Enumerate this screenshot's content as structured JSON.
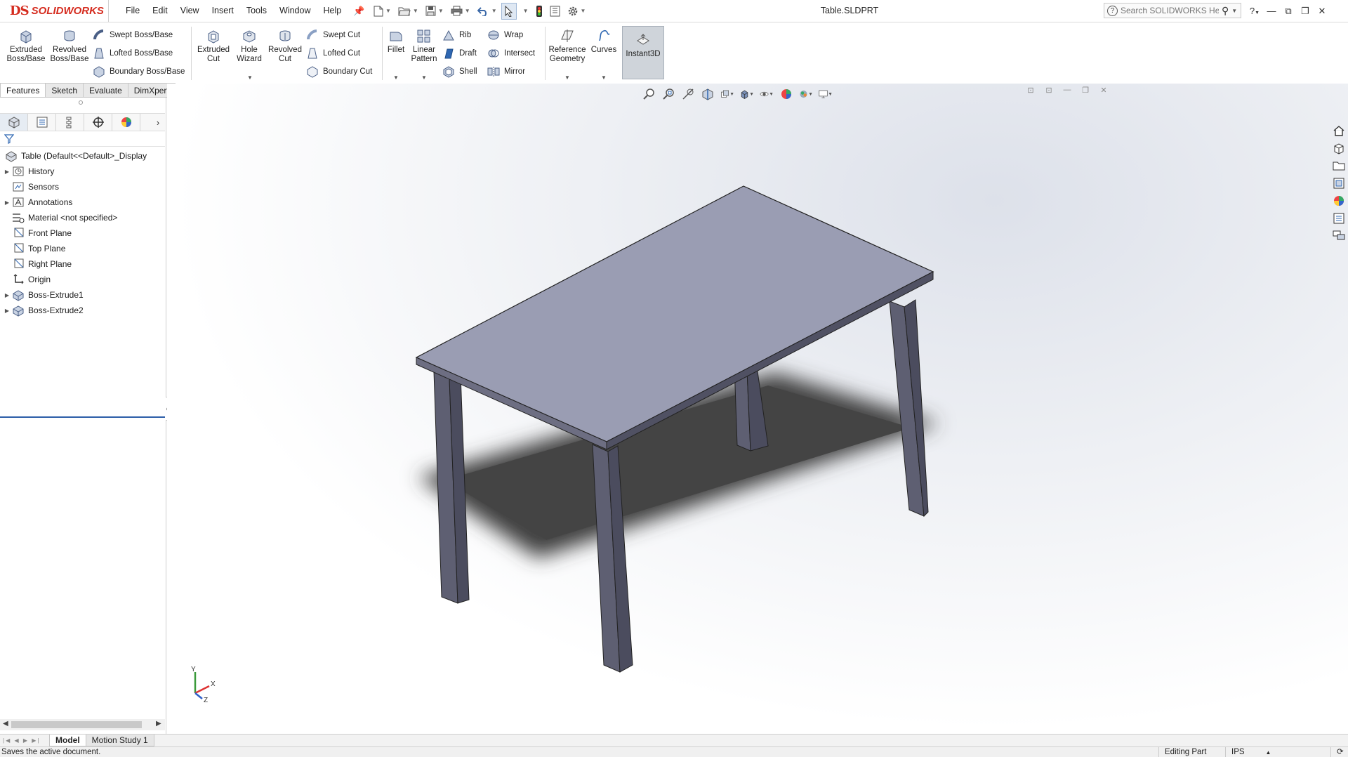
{
  "app": {
    "logo_mark": "DS",
    "logo_text": "SOLIDWORKS",
    "document_title": "Table.SLDPRT"
  },
  "menu": [
    "File",
    "Edit",
    "View",
    "Insert",
    "Tools",
    "Window",
    "Help"
  ],
  "search": {
    "placeholder": "Search SOLIDWORKS Help"
  },
  "command_manager": {
    "extruded_boss": "Extruded Boss/Base",
    "revolved_boss": "Revolved Boss/Base",
    "swept_boss": "Swept Boss/Base",
    "lofted_boss": "Lofted Boss/Base",
    "boundary_boss": "Boundary Boss/Base",
    "extruded_cut": "Extruded Cut",
    "hole_wizard": "Hole Wizard",
    "revolved_cut": "Revolved Cut",
    "swept_cut": "Swept Cut",
    "lofted_cut": "Lofted Cut",
    "boundary_cut": "Boundary Cut",
    "fillet": "Fillet",
    "linear_pattern": "Linear Pattern",
    "rib": "Rib",
    "draft": "Draft",
    "shell": "Shell",
    "wrap": "Wrap",
    "intersect": "Intersect",
    "mirror": "Mirror",
    "reference_geometry": "Reference Geometry",
    "curves": "Curves",
    "instant3d": "Instant3D"
  },
  "tabs": [
    "Features",
    "Sketch",
    "Evaluate",
    "DimXpert"
  ],
  "feature_tree": {
    "root": "Table  (Default<<Default>_Display",
    "items": [
      {
        "label": "History",
        "icon": "history-folder-icon",
        "expandable": true
      },
      {
        "label": "Sensors",
        "icon": "sensors-folder-icon",
        "expandable": false
      },
      {
        "label": "Annotations",
        "icon": "annotations-icon",
        "expandable": true
      },
      {
        "label": "Material <not specified>",
        "icon": "material-icon",
        "expandable": false
      },
      {
        "label": "Front Plane",
        "icon": "plane-icon",
        "expandable": false
      },
      {
        "label": "Top Plane",
        "icon": "plane-icon",
        "expandable": false
      },
      {
        "label": "Right Plane",
        "icon": "plane-icon",
        "expandable": false
      },
      {
        "label": "Origin",
        "icon": "origin-icon",
        "expandable": false
      },
      {
        "label": "Boss-Extrude1",
        "icon": "extrude-feature-icon",
        "expandable": true
      },
      {
        "label": "Boss-Extrude2",
        "icon": "extrude-feature-icon",
        "expandable": true
      }
    ]
  },
  "bottom_tabs": [
    "Model",
    "Motion Study 1"
  ],
  "triad": {
    "x": "X",
    "y": "Y",
    "z": "Z"
  },
  "status": {
    "message": "Saves the active document.",
    "mode": "Editing Part",
    "units": "IPS"
  },
  "colors": {
    "brand": "#d52b1e",
    "model_top": "#9a9db3",
    "model_side": "#5a5b6e",
    "selection_line": "#2c5ea8"
  }
}
